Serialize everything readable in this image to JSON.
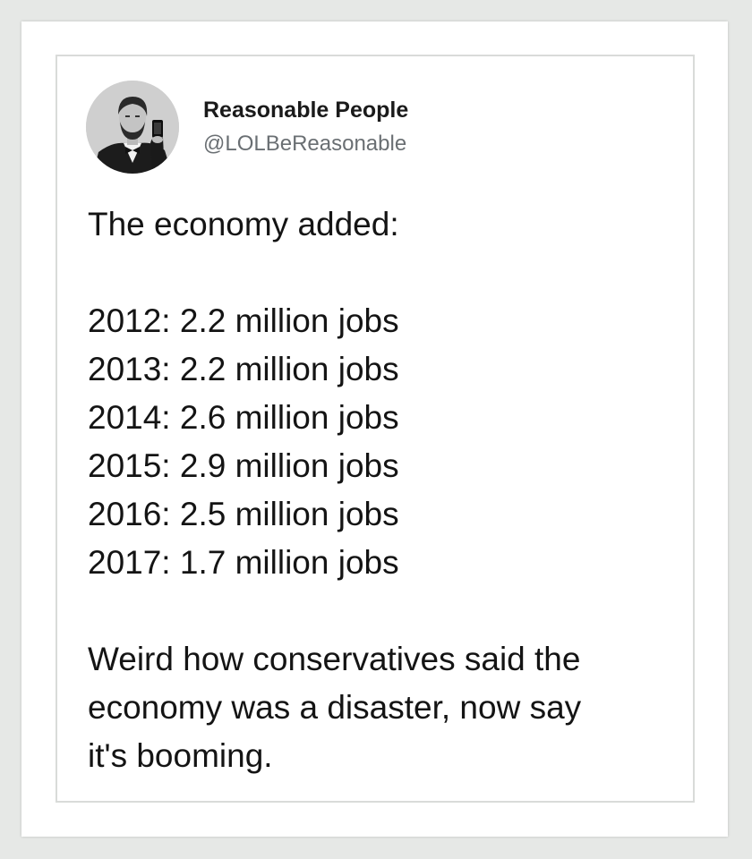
{
  "tweet": {
    "author": {
      "display_name": "Reasonable People",
      "handle": "@LOLBeReasonable",
      "avatar_icon": "lincoln-selfie-avatar"
    },
    "intro": "The economy added:",
    "job_lines": [
      "2012: 2.2 million jobs",
      "2013: 2.2 million jobs",
      "2014: 2.6 million jobs",
      "2015: 2.9 million jobs",
      "2016: 2.5 million jobs",
      "2017: 1.7 million jobs"
    ],
    "closing_lines": [
      "Weird how conservatives said the",
      "economy was a disaster, now say",
      "it's booming."
    ]
  },
  "colors": {
    "background": "#e6e8e6",
    "card": "#ffffff",
    "panel_border": "#d9dbd9",
    "text": "#141414",
    "handle_text": "#6a6f73"
  }
}
